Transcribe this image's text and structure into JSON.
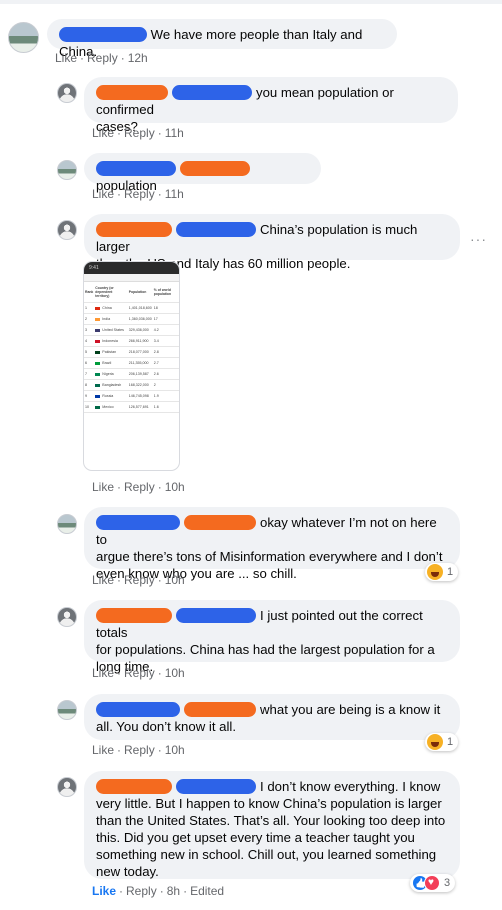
{
  "colors": {
    "bubble_bg": "#f0f2f5",
    "meta_text": "#65676b",
    "link_blue": "#1877f2",
    "redaction_blue": "#2d63e8",
    "redaction_orange": "#f46a1f"
  },
  "comments": [
    {
      "text": "We have more people than Italy and China.",
      "actions": [
        "Like",
        "Reply",
        "12h"
      ]
    },
    {
      "text": "you mean population or confirmed\ncases?",
      "actions": [
        "Like",
        "Reply",
        "11h"
      ]
    },
    {
      "text": "population",
      "actions": [
        "Like",
        "Reply",
        "11h"
      ]
    },
    {
      "text": "China’s population is much larger\nthan the US and Italy has 60 million people.",
      "actions": [
        "Like",
        "Reply",
        "10h"
      ],
      "more_icon": "more-horizontal-icon",
      "attachment": {
        "type": "screenshot",
        "table_headers": [
          "Rank",
          "Country (or dependent territory)",
          "Population",
          "% of world population"
        ],
        "rows": [
          {
            "rank": "1",
            "name": "China",
            "pop": "1,401,018,600",
            "pct": "18",
            "flag": "#de2910"
          },
          {
            "rank": "2",
            "name": "India",
            "pop": "1,360,036,000",
            "pct": "17",
            "flag": "#ff9933"
          },
          {
            "rank": "3",
            "name": "United States",
            "pop": "329,436,000",
            "pct": "4.2",
            "flag": "#3c3b6e"
          },
          {
            "rank": "4",
            "name": "Indonesia",
            "pop": "266,911,900",
            "pct": "3.4",
            "flag": "#ce1126"
          },
          {
            "rank": "5",
            "name": "Pakistan",
            "pop": "218,077,000",
            "pct": "2.8",
            "flag": "#01411c"
          },
          {
            "rank": "6",
            "name": "Brazil",
            "pop": "211,355,000",
            "pct": "2.7",
            "flag": "#009c3b"
          },
          {
            "rank": "7",
            "name": "Nigeria",
            "pop": "206,139,587",
            "pct": "2.6",
            "flag": "#008751"
          },
          {
            "rank": "8",
            "name": "Bangladesh",
            "pop": "168,322,000",
            "pct": "2",
            "flag": "#006a4e"
          },
          {
            "rank": "9",
            "name": "Russia",
            "pop": "146,745,098",
            "pct": "1.9",
            "flag": "#0039a6"
          },
          {
            "rank": "10",
            "name": "Mexico",
            "pop": "126,577,691",
            "pct": "1.6",
            "flag": "#006847"
          }
        ]
      }
    },
    {
      "text": "okay whatever I’m not on here to\nargue there’s tons of Misinformation everywhere and I don’t\neven know who you are ... so chill.",
      "actions": [
        "Like",
        "Reply",
        "10h"
      ],
      "reaction": {
        "icons": [
          "haha-reaction-icon"
        ],
        "count": "1"
      }
    },
    {
      "text": "I just pointed out the correct totals\nfor populations. China has had the largest population for a\nlong time.",
      "actions": [
        "Like",
        "Reply",
        "10h"
      ]
    },
    {
      "text": "what you are being is a know it\nall. You don’t know it all.",
      "actions": [
        "Like",
        "Reply",
        "10h"
      ],
      "reaction": {
        "icons": [
          "haha-reaction-icon"
        ],
        "count": "1"
      }
    },
    {
      "text": "I don’t know everything. I know\nvery little. But I happen to know China’s population is larger\nthan the United States. That’s all. Your looking too deep into\nthis. Did you get upset every time a teacher taught you\nsomething new in school. Chill out, you learned something\nnew today.",
      "actions": [
        "Like",
        "Reply",
        "8h",
        "Edited"
      ],
      "reaction": {
        "icons": [
          "like-reaction-icon",
          "love-reaction-icon"
        ],
        "count": "3"
      }
    }
  ]
}
